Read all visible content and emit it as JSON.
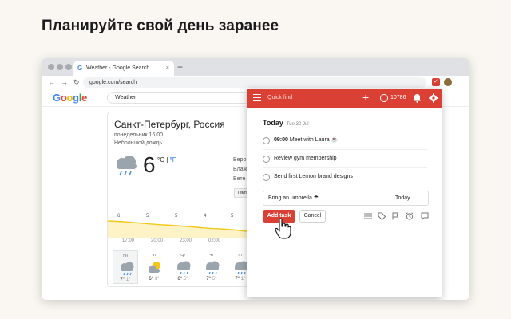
{
  "promo": {
    "title": "Планируйте свой день заранее"
  },
  "browser": {
    "tab_title": "Weather - Google Search",
    "tab_favicon": "G",
    "tab_close": "×",
    "new_tab": "+",
    "back": "←",
    "forward": "→",
    "reload": "↻",
    "url": "google.com/search",
    "menu": "⋮"
  },
  "google": {
    "logo_letters": [
      "G",
      "o",
      "o",
      "g",
      "l",
      "e"
    ],
    "logo_colors": [
      "#4285f4",
      "#ea4335",
      "#fbbc05",
      "#4285f4",
      "#34a853",
      "#ea4335"
    ],
    "search_value": "Weather"
  },
  "weather": {
    "city": "Санкт-Петербург, Россия",
    "day_time": "понедельник 16:00",
    "condition": "Небольшой дождь",
    "temp": "6",
    "unit_c": "°C",
    "unit_sep": "|",
    "unit_f": "°F",
    "side_lines": [
      "Веро",
      "Влаж",
      "Вете"
    ],
    "temp_button": "Температура",
    "graph_values": [
      "6",
      "5",
      "5",
      "4",
      "5"
    ],
    "graph_times": [
      "17:00",
      "20:00",
      "23:00",
      "02:00"
    ],
    "days": [
      {
        "name": "пн",
        "hi": "7",
        "lo": "1",
        "icon": "rain-cloud-icon"
      },
      {
        "name": "вт",
        "hi": "6",
        "lo": "3",
        "icon": "sun-cloud-icon"
      },
      {
        "name": "ср",
        "hi": "6",
        "lo": "5",
        "icon": "rain-cloud-icon"
      },
      {
        "name": "чт",
        "hi": "7",
        "lo": "5",
        "icon": "rain-cloud-icon"
      },
      {
        "name": "пт",
        "hi": "7",
        "lo": "1",
        "icon": "rain-cloud-icon"
      }
    ]
  },
  "todoist": {
    "accent": "#db4035",
    "quick_find": "Quick find",
    "karma_count": "10786",
    "today_label": "Today",
    "today_date": "Tue 30 Jul",
    "tasks": [
      {
        "time": "09:00",
        "text": "Meet with Laura ☕"
      },
      {
        "time": "",
        "text": "Review gym membership"
      },
      {
        "time": "",
        "text": "Send first Lemon brand designs"
      }
    ],
    "editor_value": "Bring an umbrella ☂",
    "editor_date": "Today",
    "add_button": "Add task",
    "cancel_button": "Cancel",
    "editor_icons": [
      "list-icon",
      "label-icon",
      "flag-icon",
      "alarm-icon",
      "comment-icon"
    ]
  }
}
